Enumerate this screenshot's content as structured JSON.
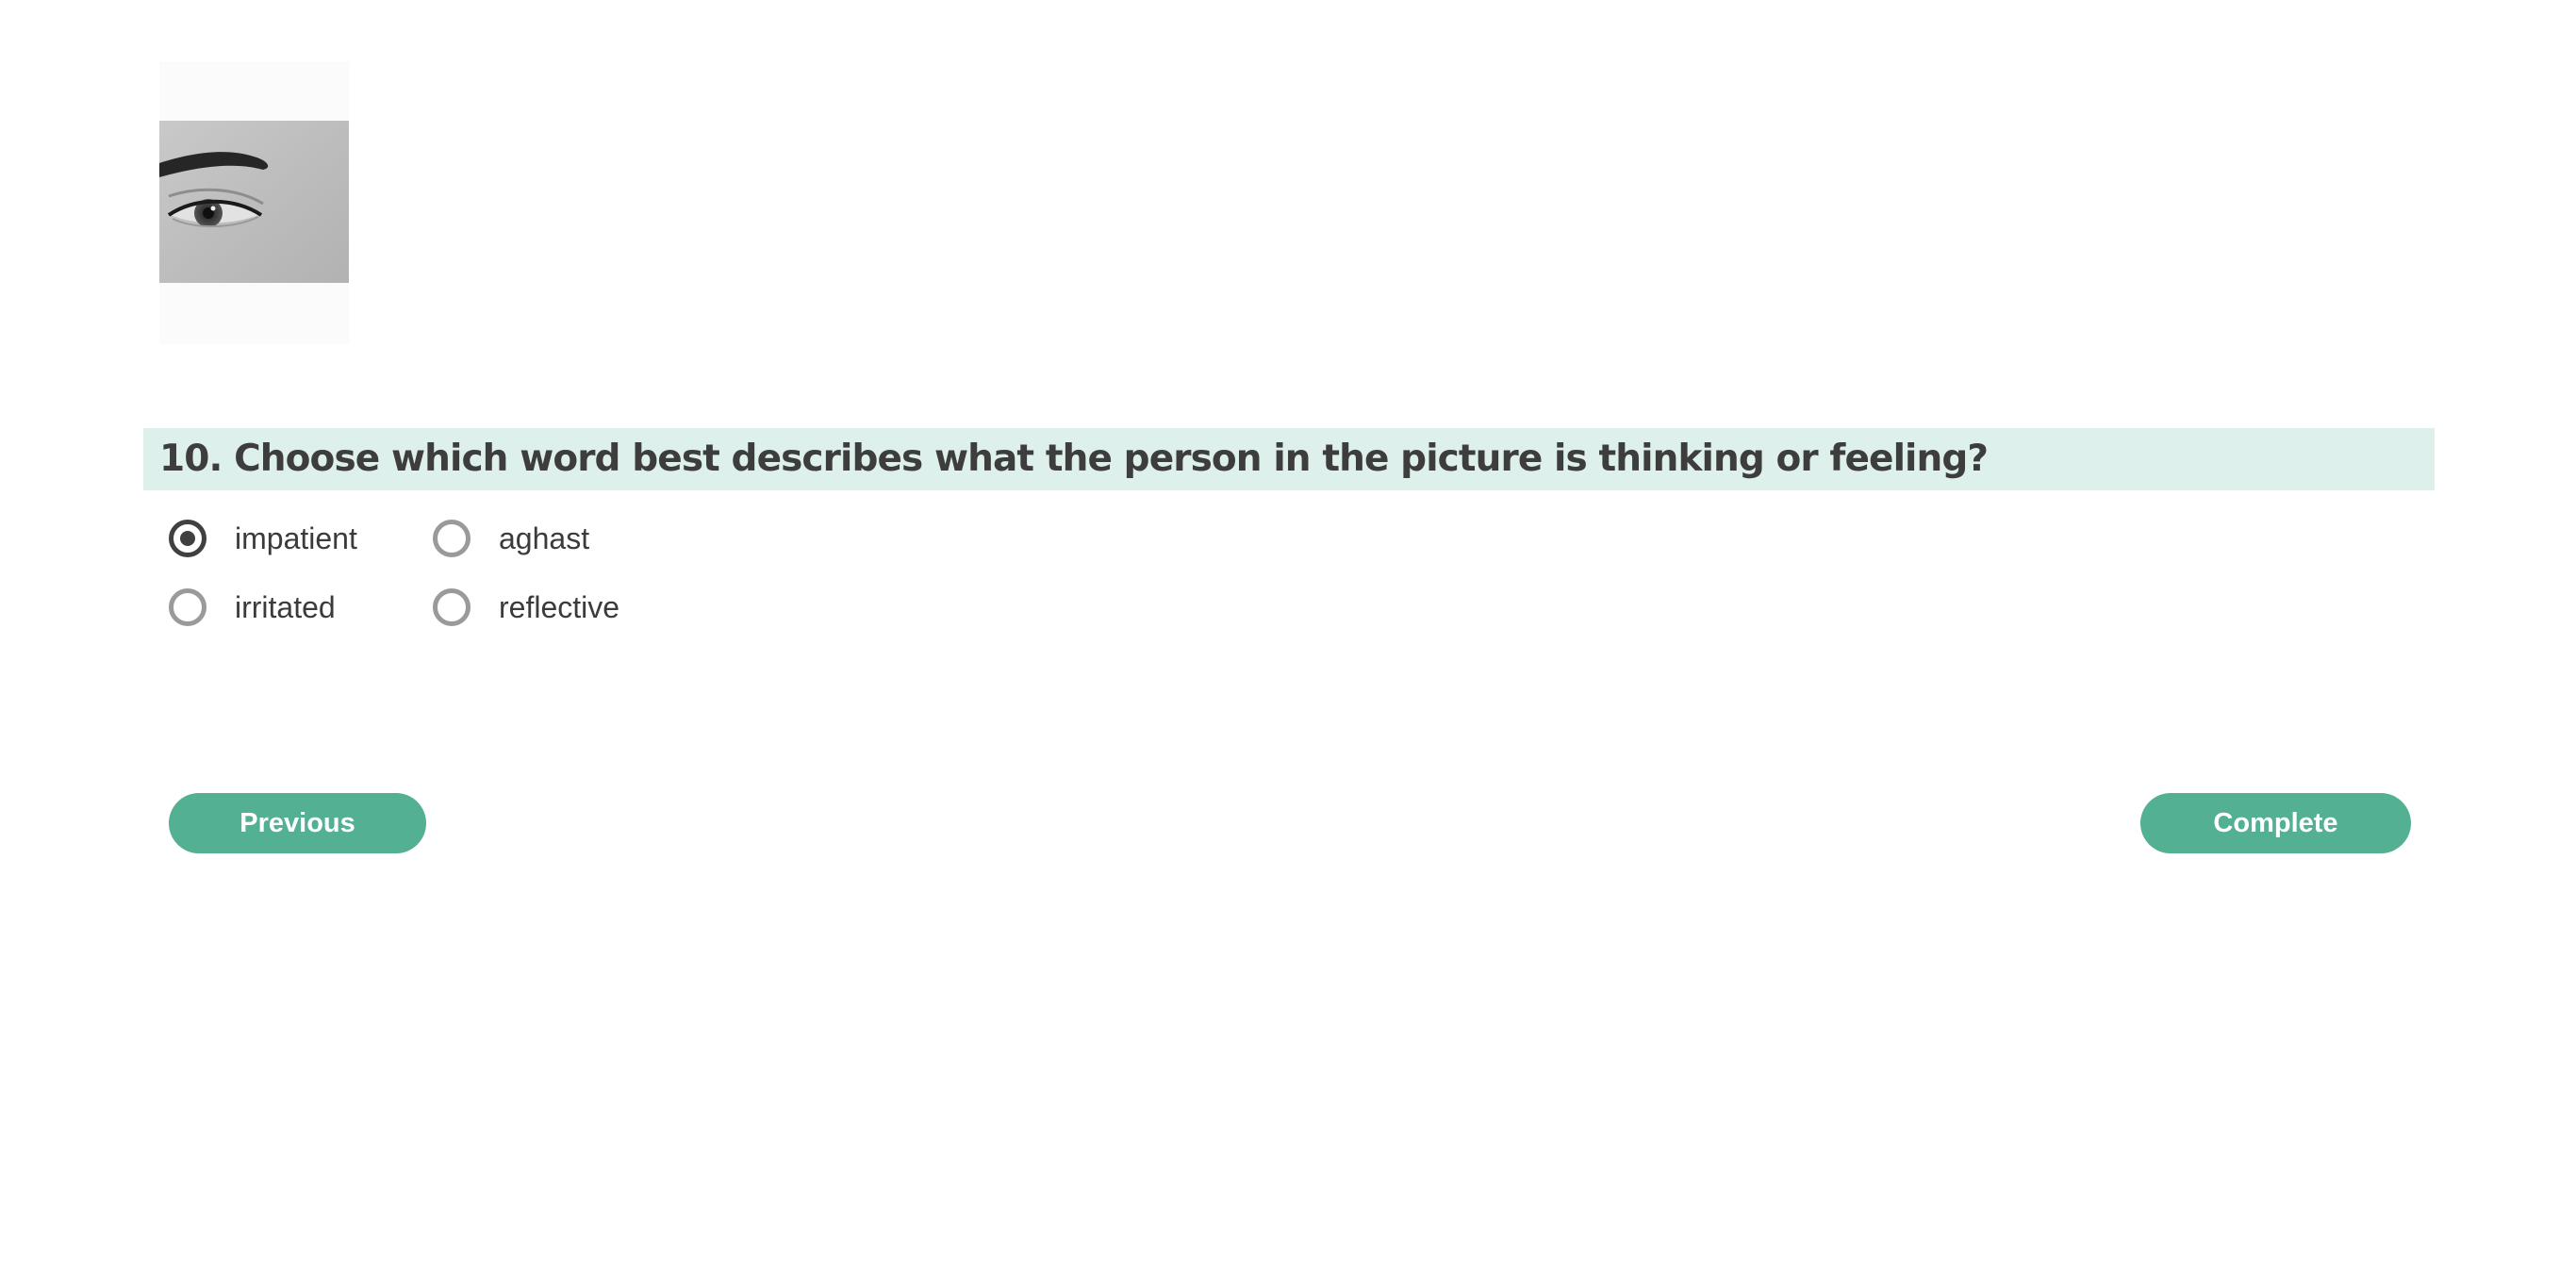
{
  "question": {
    "title": "10. Choose which word best describes what the person in the picture is thinking or feeling?"
  },
  "options": [
    {
      "label": "impatient",
      "selected": true
    },
    {
      "label": "aghast",
      "selected": false
    },
    {
      "label": "irritated",
      "selected": false
    },
    {
      "label": "reflective",
      "selected": false
    }
  ],
  "buttons": {
    "previous": "Previous",
    "complete": "Complete"
  },
  "colors": {
    "accent": "#53b093",
    "question_bar": "#def0eb",
    "text": "#3b3b3b"
  }
}
